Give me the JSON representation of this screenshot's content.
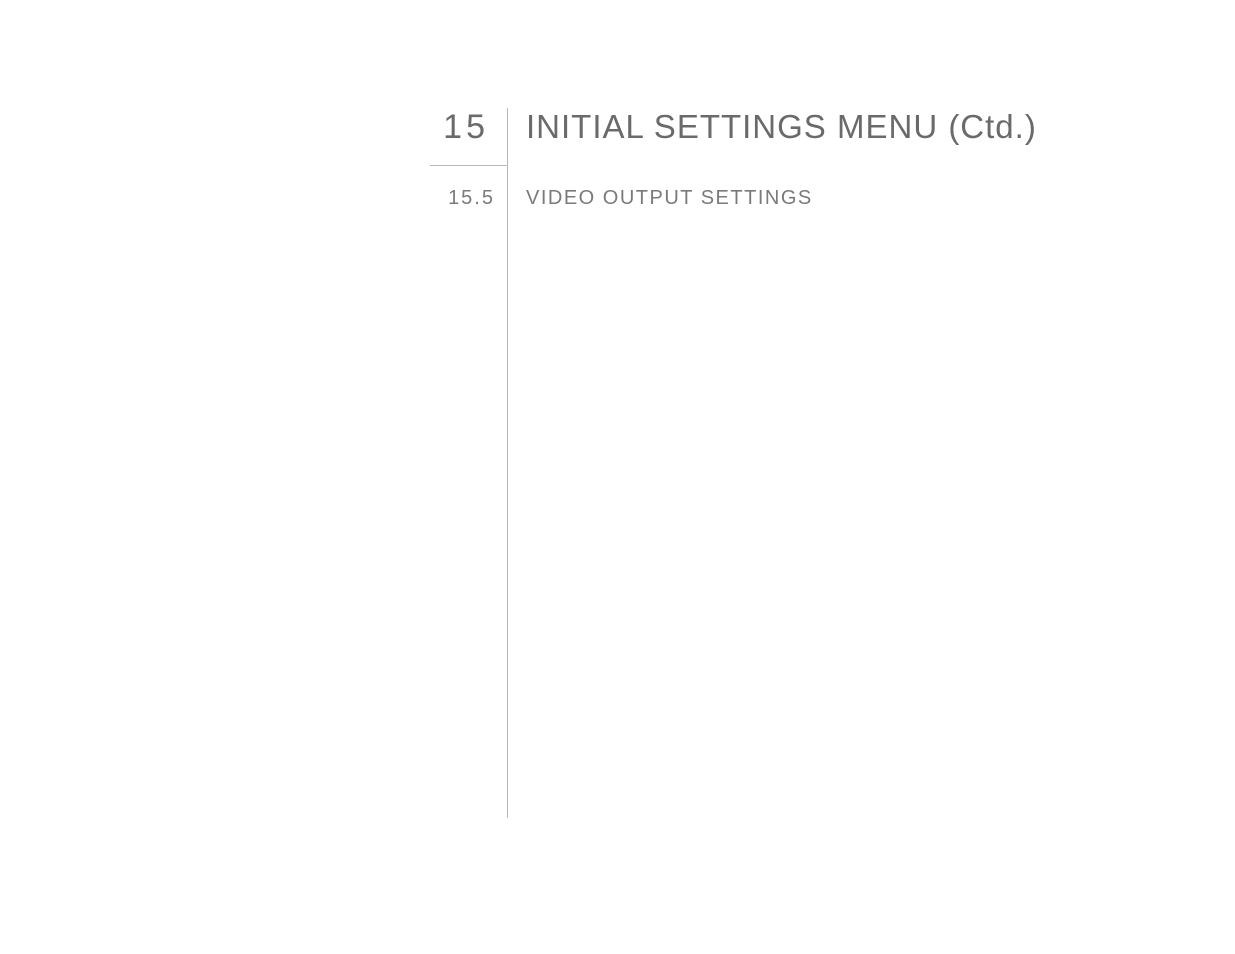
{
  "chapter": {
    "number": "15",
    "title": "INITIAL SETTINGS MENU (Ctd.)"
  },
  "section": {
    "number": "15.5",
    "title": "VIDEO OUTPUT SETTINGS"
  }
}
